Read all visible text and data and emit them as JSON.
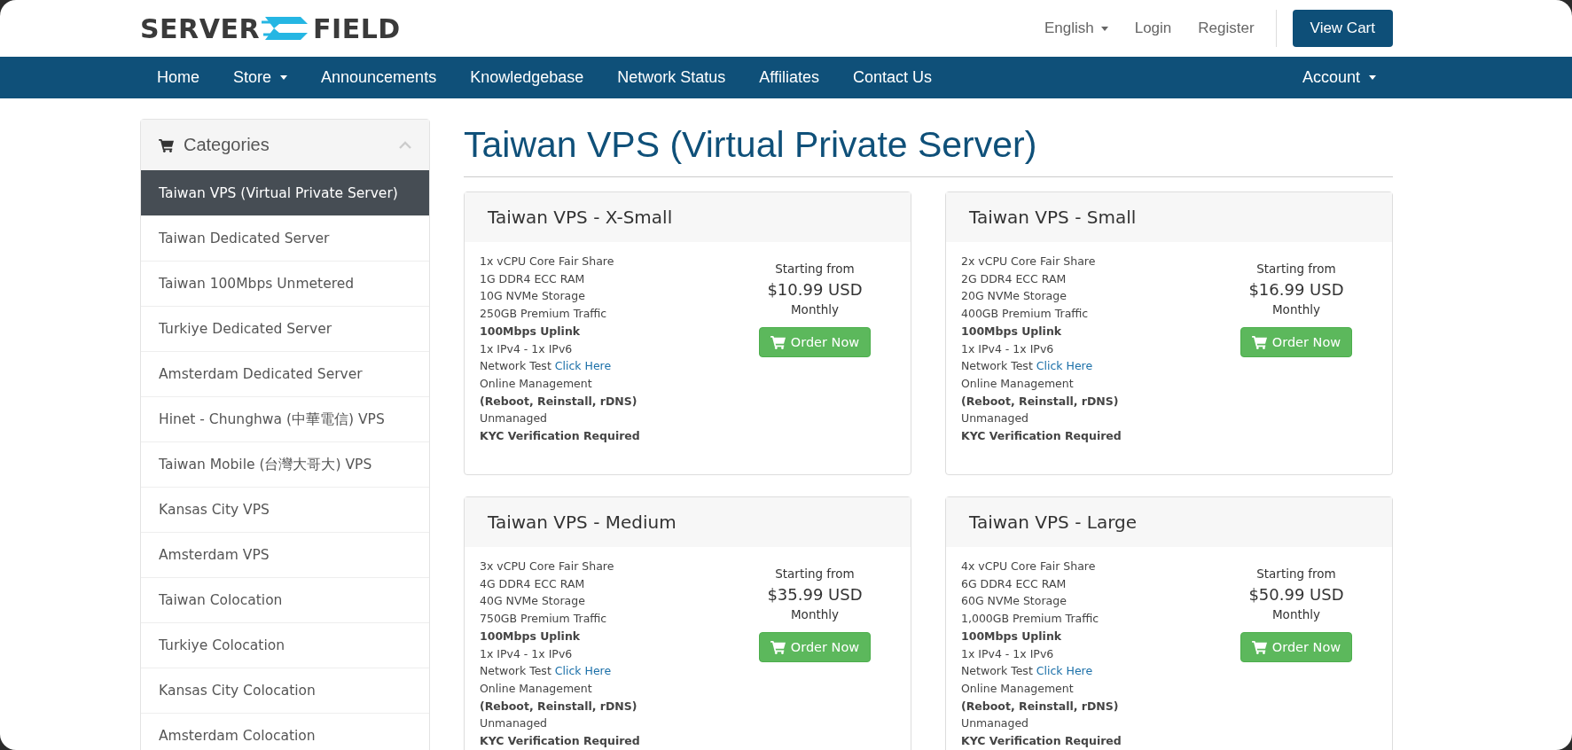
{
  "header": {
    "logo": {
      "left": "SERVER",
      "right": "FIELD"
    },
    "language": "English",
    "login": "Login",
    "register": "Register",
    "cart_button": "View Cart"
  },
  "nav": {
    "items": [
      {
        "label": "Home",
        "dropdown": false
      },
      {
        "label": "Store",
        "dropdown": true
      },
      {
        "label": "Announcements",
        "dropdown": false
      },
      {
        "label": "Knowledgebase",
        "dropdown": false
      },
      {
        "label": "Network Status",
        "dropdown": false
      },
      {
        "label": "Affiliates",
        "dropdown": false
      },
      {
        "label": "Contact Us",
        "dropdown": false
      }
    ],
    "account": "Account"
  },
  "sidebar": {
    "title": "Categories",
    "expanded": true,
    "items": [
      {
        "label": "Taiwan VPS (Virtual Private Server)",
        "selected": true
      },
      {
        "label": "Taiwan Dedicated Server",
        "selected": false
      },
      {
        "label": "Taiwan 100Mbps Unmetered",
        "selected": false
      },
      {
        "label": "Turkiye Dedicated Server",
        "selected": false
      },
      {
        "label": "Amsterdam Dedicated Server",
        "selected": false
      },
      {
        "label": "Hinet - Chunghwa (中華電信) VPS",
        "selected": false
      },
      {
        "label": "Taiwan Mobile (台灣大哥大) VPS",
        "selected": false
      },
      {
        "label": "Kansas City VPS",
        "selected": false
      },
      {
        "label": "Amsterdam VPS",
        "selected": false
      },
      {
        "label": "Taiwan Colocation",
        "selected": false
      },
      {
        "label": "Turkiye Colocation",
        "selected": false
      },
      {
        "label": "Kansas City Colocation",
        "selected": false
      },
      {
        "label": "Amsterdam Colocation",
        "selected": false
      }
    ]
  },
  "page_title": "Taiwan VPS (Virtual Private Server)",
  "products": [
    {
      "name": "Taiwan VPS - X-Small",
      "features": [
        {
          "kind": "plain",
          "text": "1x vCPU Core Fair Share"
        },
        {
          "kind": "plain",
          "text": "1G DDR4 ECC RAM"
        },
        {
          "kind": "plain",
          "text": "10G NVMe Storage"
        },
        {
          "kind": "plain",
          "text": "250GB Premium Traffic"
        },
        {
          "kind": "bold",
          "text": "100Mbps Uplink"
        },
        {
          "kind": "plain",
          "text": "1x IPv4 - 1x IPv6"
        },
        {
          "kind": "link",
          "text": "Network Test",
          "link": "Click Here"
        },
        {
          "kind": "plain",
          "text": "Online Management"
        },
        {
          "kind": "bold",
          "text": "(Reboot, Reinstall, rDNS)"
        },
        {
          "kind": "plain",
          "text": "Unmanaged"
        },
        {
          "kind": "bold",
          "text": "KYC Verification Required"
        }
      ],
      "starting": "Starting from",
      "price": "$10.99 USD",
      "cycle": "Monthly",
      "button": "Order Now"
    },
    {
      "name": "Taiwan VPS - Small",
      "features": [
        {
          "kind": "plain",
          "text": "2x vCPU Core Fair Share"
        },
        {
          "kind": "plain",
          "text": "2G DDR4 ECC RAM"
        },
        {
          "kind": "plain",
          "text": "20G NVMe Storage"
        },
        {
          "kind": "plain",
          "text": "400GB Premium Traffic"
        },
        {
          "kind": "bold",
          "text": "100Mbps Uplink"
        },
        {
          "kind": "plain",
          "text": "1x IPv4 - 1x IPv6"
        },
        {
          "kind": "link",
          "text": "Network Test",
          "link": "Click Here"
        },
        {
          "kind": "plain",
          "text": "Online Management"
        },
        {
          "kind": "bold",
          "text": "(Reboot, Reinstall, rDNS)"
        },
        {
          "kind": "plain",
          "text": "Unmanaged"
        },
        {
          "kind": "bold",
          "text": "KYC Verification Required"
        }
      ],
      "starting": "Starting from",
      "price": "$16.99 USD",
      "cycle": "Monthly",
      "button": "Order Now"
    },
    {
      "name": "Taiwan VPS - Medium",
      "features": [
        {
          "kind": "plain",
          "text": "3x vCPU Core Fair Share"
        },
        {
          "kind": "plain",
          "text": "4G DDR4 ECC RAM"
        },
        {
          "kind": "plain",
          "text": "40G NVMe Storage"
        },
        {
          "kind": "plain",
          "text": "750GB Premium Traffic"
        },
        {
          "kind": "bold",
          "text": "100Mbps Uplink"
        },
        {
          "kind": "plain",
          "text": "1x IPv4 - 1x IPv6"
        },
        {
          "kind": "link",
          "text": "Network Test",
          "link": "Click Here"
        },
        {
          "kind": "plain",
          "text": "Online Management"
        },
        {
          "kind": "bold",
          "text": "(Reboot, Reinstall, rDNS)"
        },
        {
          "kind": "plain",
          "text": "Unmanaged"
        },
        {
          "kind": "bold",
          "text": "KYC Verification Required"
        }
      ],
      "starting": "Starting from",
      "price": "$35.99 USD",
      "cycle": "Monthly",
      "button": "Order Now"
    },
    {
      "name": "Taiwan VPS - Large",
      "features": [
        {
          "kind": "plain",
          "text": "4x vCPU Core Fair Share"
        },
        {
          "kind": "plain",
          "text": "6G DDR4 ECC RAM"
        },
        {
          "kind": "plain",
          "text": "60G NVMe Storage"
        },
        {
          "kind": "plain",
          "text": "1,000GB Premium Traffic"
        },
        {
          "kind": "bold",
          "text": "100Mbps Uplink"
        },
        {
          "kind": "plain",
          "text": "1x IPv4 - 1x IPv6"
        },
        {
          "kind": "link",
          "text": "Network Test",
          "link": "Click Here"
        },
        {
          "kind": "plain",
          "text": "Online Management"
        },
        {
          "kind": "bold",
          "text": "(Reboot, Reinstall, rDNS)"
        },
        {
          "kind": "plain",
          "text": "Unmanaged"
        },
        {
          "kind": "bold",
          "text": "KYC Verification Required"
        }
      ],
      "starting": "Starting from",
      "price": "$50.99 USD",
      "cycle": "Monthly",
      "button": "Order Now"
    }
  ]
}
